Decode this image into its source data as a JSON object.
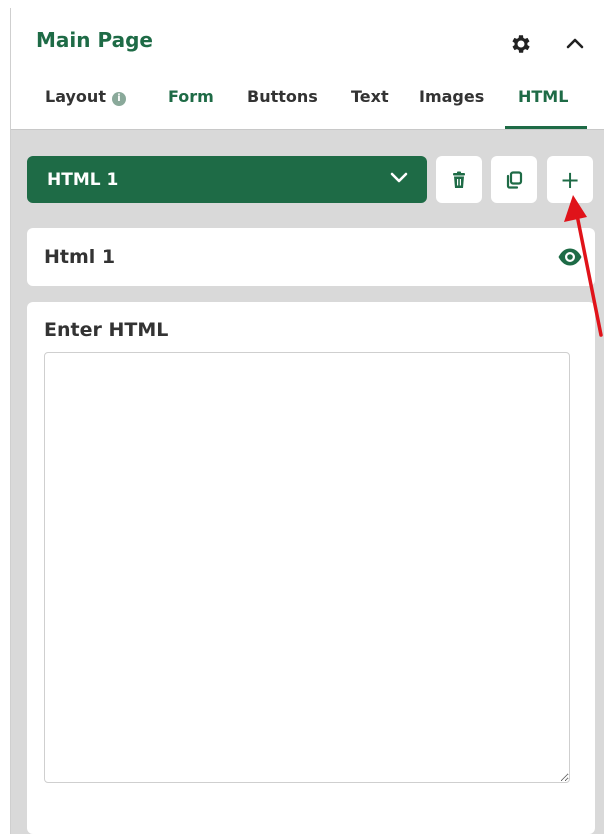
{
  "header": {
    "title": "Main Page",
    "settings_icon": "gear-icon",
    "collapse_icon": "chevron-up-icon"
  },
  "tabs": [
    {
      "label": "Layout",
      "info_icon": "info-icon"
    },
    {
      "label": "Form"
    },
    {
      "label": "Buttons"
    },
    {
      "label": "Text"
    },
    {
      "label": "Images"
    },
    {
      "label": "HTML",
      "active": true
    }
  ],
  "selector": {
    "value": "HTML 1",
    "dropdown_icon": "chevron-down-icon"
  },
  "toolbar": {
    "delete_icon": "trash-icon",
    "duplicate_icon": "copy-icon",
    "add_label": "+"
  },
  "item": {
    "name": "Html 1",
    "visibility_icon": "eye-icon"
  },
  "editor": {
    "label": "Enter HTML",
    "value": "",
    "placeholder": ""
  },
  "annotation": {
    "arrow_color": "#e0131a"
  },
  "colors": {
    "brand_green": "#1e6b46",
    "panel_bg": "#d9d9d9"
  }
}
